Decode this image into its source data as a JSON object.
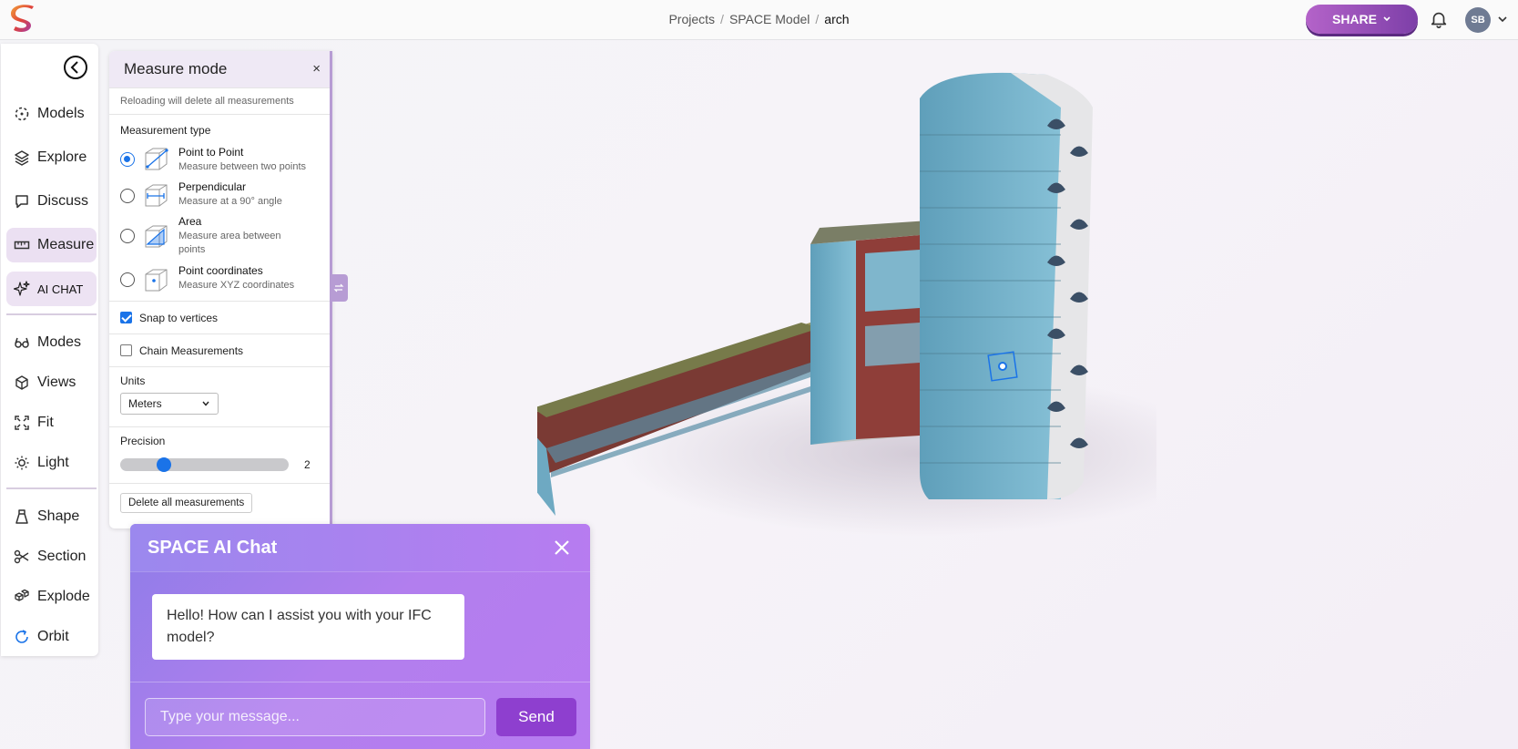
{
  "breadcrumb": {
    "root": "Projects",
    "parent": "SPACE Model",
    "current": "arch"
  },
  "header": {
    "share_label": "SHARE",
    "avatar_initials": "SB",
    "share_color": "#9b4fc0"
  },
  "sidebar": {
    "items": [
      {
        "label": "Models",
        "icon": "models-icon"
      },
      {
        "label": "Explore",
        "icon": "layers-icon"
      },
      {
        "label": "Discuss",
        "icon": "chat-bubble-icon"
      },
      {
        "label": "Measure",
        "icon": "ruler-icon",
        "active": true
      },
      {
        "label": "AI CHAT",
        "icon": "sparkle-icon"
      },
      {
        "label": "Modes",
        "icon": "glasses-icon"
      },
      {
        "label": "Views",
        "icon": "cube-view-icon"
      },
      {
        "label": "Fit",
        "icon": "fit-icon"
      },
      {
        "label": "Light",
        "icon": "sun-icon"
      },
      {
        "label": "Shape",
        "icon": "shape-icon"
      },
      {
        "label": "Section",
        "icon": "scissors-icon"
      },
      {
        "label": "Explode",
        "icon": "explode-icon"
      },
      {
        "label": "Orbit",
        "icon": "orbit-icon"
      }
    ]
  },
  "measure": {
    "title": "Measure mode",
    "close": "×",
    "note": "Reloading will delete all measurements",
    "type_title": "Measurement type",
    "types": [
      {
        "label": "Point to Point",
        "desc": "Measure between two points",
        "selected": true
      },
      {
        "label": "Perpendicular",
        "desc": "Measure at a 90° angle",
        "selected": false
      },
      {
        "label": "Area",
        "desc": "Measure area between points",
        "selected": false
      },
      {
        "label": "Point coordinates",
        "desc": "Measure XYZ coordinates",
        "selected": false
      }
    ],
    "snap_label": "Snap to vertices",
    "snap_checked": true,
    "chain_label": "Chain Measurements",
    "chain_checked": false,
    "units_label": "Units",
    "units_value": "Meters",
    "precision_label": "Precision",
    "precision_value": "2",
    "delete_label": "Delete all measurements"
  },
  "chat": {
    "title": "SPACE AI Chat",
    "message": "Hello! How can I assist you with your IFC model?",
    "input_placeholder": "Type your message...",
    "send_label": "Send"
  }
}
